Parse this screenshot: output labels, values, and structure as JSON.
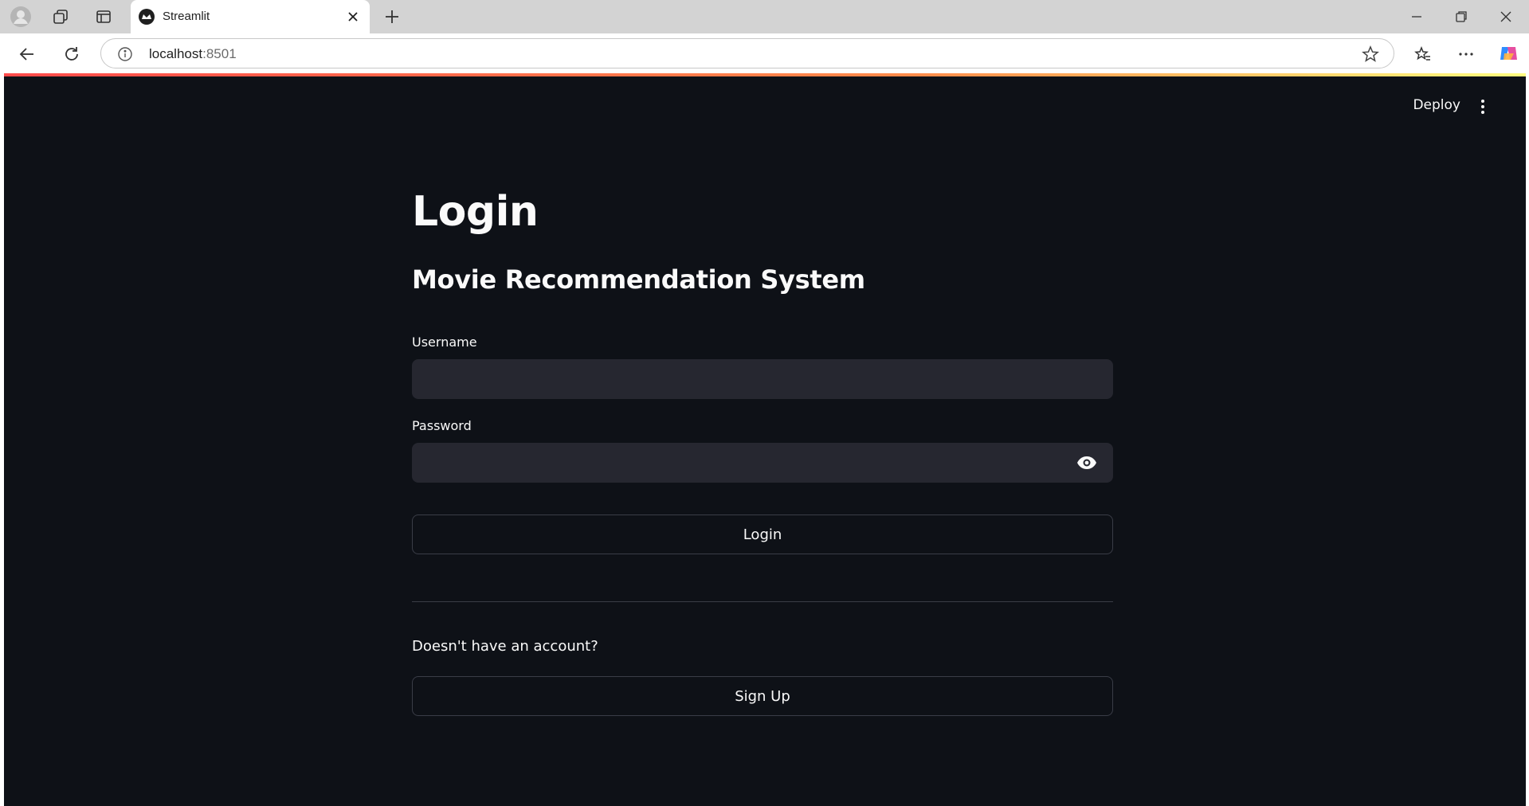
{
  "browser": {
    "tab_title": "Streamlit",
    "url_host": "localhost",
    "url_port": ":8501"
  },
  "app": {
    "deploy_label": "Deploy",
    "title": "Login",
    "subtitle": "Movie Recommendation System",
    "username_label": "Username",
    "username_value": "",
    "password_label": "Password",
    "password_value": "",
    "login_button": "Login",
    "account_prompt": "Doesn't have an account?",
    "signup_button": "Sign Up"
  },
  "colors": {
    "app_bg": "#0e1117",
    "input_bg": "#262730",
    "text": "#fafafa",
    "accent_gradient_start": "#ff4b4b",
    "accent_gradient_end": "#fffd80"
  },
  "icons": [
    "profile-icon",
    "collections-icon",
    "tab-actions-icon",
    "streamlit-favicon",
    "close-icon",
    "new-tab-icon",
    "minimize-icon",
    "restore-icon",
    "window-close-icon",
    "back-icon",
    "refresh-icon",
    "info-icon",
    "favorite-star-icon",
    "favorites-icon",
    "more-icon",
    "copilot-icon",
    "kebab-menu-icon",
    "eye-icon"
  ]
}
